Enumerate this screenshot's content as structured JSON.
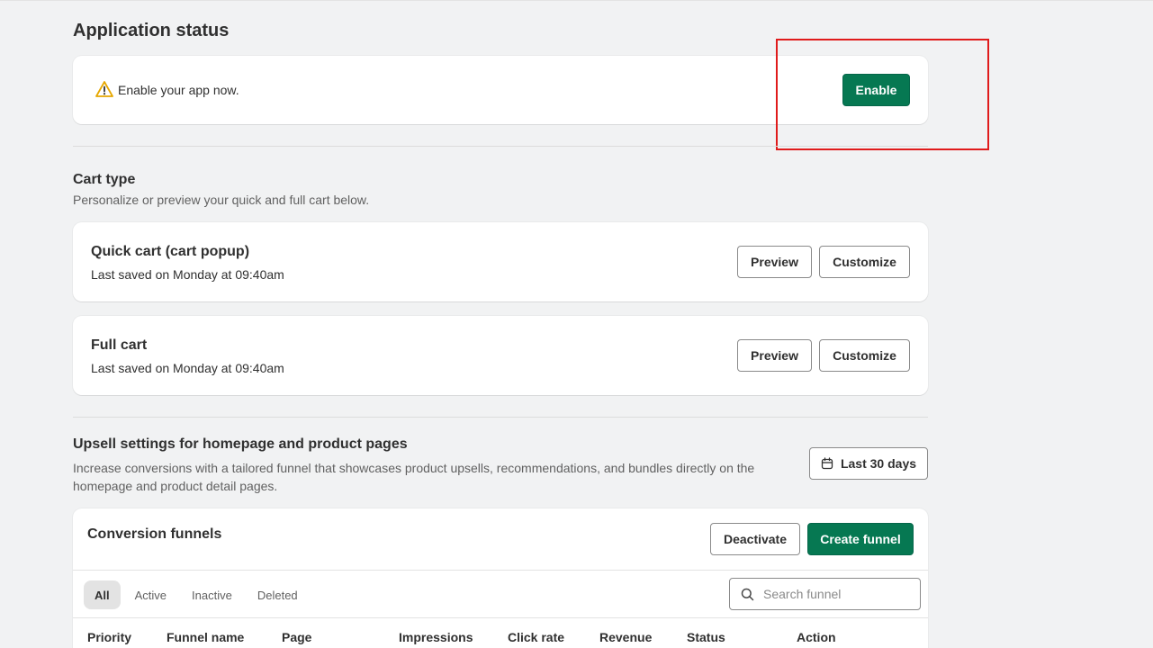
{
  "application_status": {
    "title": "Application status",
    "warning_text": "Enable your app now.",
    "enable_label": "Enable"
  },
  "cart_type": {
    "title": "Cart type",
    "subtitle": "Personalize or preview your quick and full cart below.",
    "carts": [
      {
        "name": "Quick cart (cart popup)",
        "last_saved": "Last saved on Monday at 09:40am",
        "preview_label": "Preview",
        "customize_label": "Customize"
      },
      {
        "name": "Full cart",
        "last_saved": "Last saved on Monday at 09:40am",
        "preview_label": "Preview",
        "customize_label": "Customize"
      }
    ]
  },
  "upsell": {
    "title": "Upsell settings for homepage and product pages",
    "description_line1": "Increase conversions with a tailored funnel that showcases product upsells, recommendations, and bundles directly on the",
    "description_line2": "homepage and product detail pages.",
    "date_range_label": "Last 30 days"
  },
  "funnels": {
    "title": "Conversion funnels",
    "deactivate_label": "Deactivate",
    "create_label": "Create funnel",
    "tabs": [
      "All",
      "Active",
      "Inactive",
      "Deleted"
    ],
    "search_placeholder": "Search funnel",
    "columns": [
      "Priority",
      "Funnel name",
      "Page",
      "Impressions",
      "Click rate",
      "Revenue",
      "Status",
      "Action"
    ]
  },
  "colors": {
    "primary": "#067852",
    "annotation": "#e01b1b",
    "warning": "#e6a700"
  }
}
